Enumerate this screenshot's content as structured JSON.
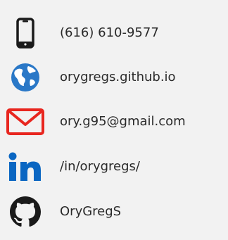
{
  "contacts": {
    "phone": {
      "text": "(616) 610-9577",
      "icon": "phone-icon",
      "color": "#1a1a1a"
    },
    "website": {
      "text": "orygregs.github.io",
      "icon": "globe-icon",
      "color": "#2a78c7"
    },
    "email": {
      "text": "ory.g95@gmail.com",
      "icon": "envelope-icon",
      "color": "#e8261f"
    },
    "linkedin": {
      "text": "/in/orygregs/",
      "icon": "linkedin-icon",
      "color": "#0a66c2"
    },
    "github": {
      "text": "OryGregS",
      "icon": "github-icon",
      "color": "#1a1a1a"
    }
  }
}
